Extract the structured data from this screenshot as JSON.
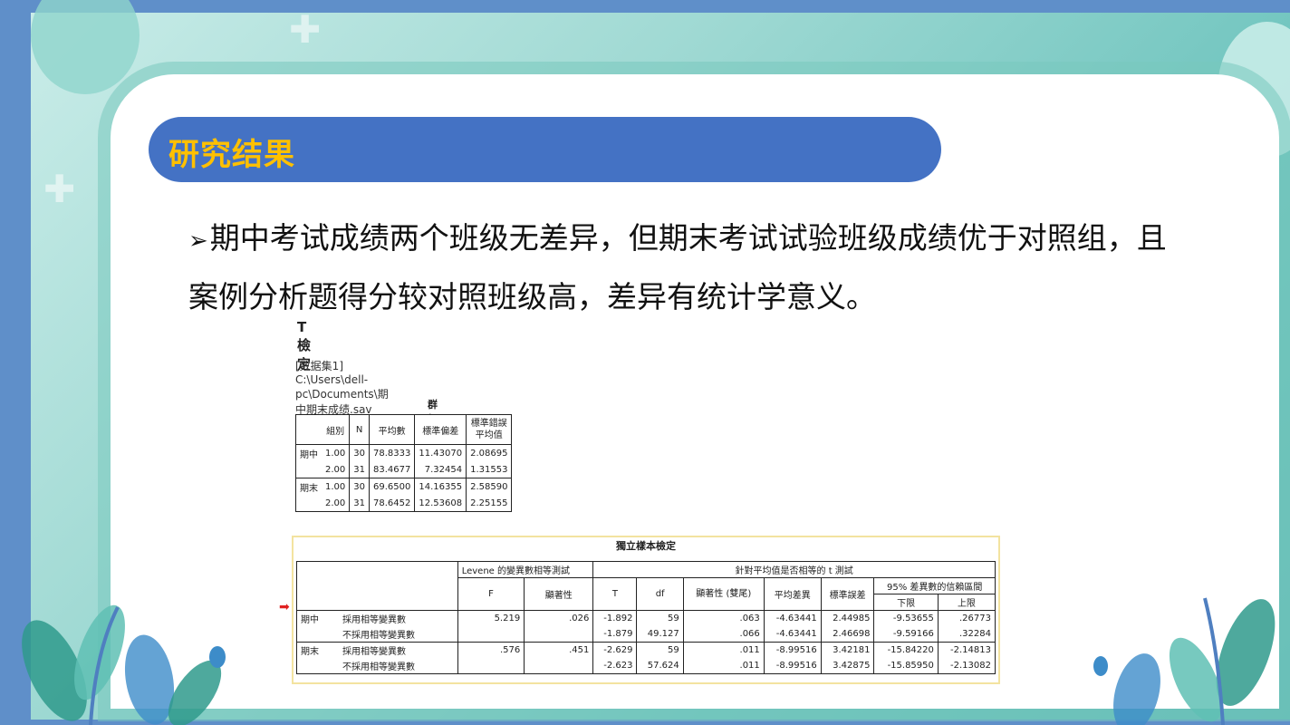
{
  "slide": {
    "title": "研究结果",
    "bullet": "➢",
    "line1": "期中考试成绩两个班级无差异，但期末考试试验班级成绩优于对照组，且",
    "line2": "案例分析题得分较对照班级高，差异有统计学意义。"
  },
  "spss": {
    "heading": "T 檢定",
    "dataset": "[数据集1] C:\\Users\\dell-pc\\Documents\\期中期末成绩.sav",
    "group_stats": {
      "caption": "群組統計資料",
      "headers": [
        "",
        "組別",
        "N",
        "平均數",
        "標準偏差",
        "標準錯誤平均值"
      ],
      "rows": [
        [
          "期中",
          "1.00",
          "30",
          "78.8333",
          "11.43070",
          "2.08695"
        ],
        [
          "",
          "2.00",
          "31",
          "83.4677",
          "7.32454",
          "1.31553"
        ],
        [
          "期末",
          "1.00",
          "30",
          "69.6500",
          "14.16355",
          "2.58590"
        ],
        [
          "",
          "2.00",
          "31",
          "78.6452",
          "12.53608",
          "2.25155"
        ]
      ]
    },
    "independent": {
      "caption": "獨立樣本檢定",
      "levene_header": "Levene 的變異數相等測試",
      "ttest_header": "針對平均值是否相等的 t 測試",
      "ci_header": "95% 差異數的信賴區間",
      "col_headers": [
        "F",
        "顯著性",
        "T",
        "df",
        "顯著性 (雙尾)",
        "平均差異",
        "標準誤差",
        "下限",
        "上限"
      ],
      "rows": [
        [
          "期中",
          "採用相等變異數",
          "5.219",
          ".026",
          "-1.892",
          "59",
          ".063",
          "-4.63441",
          "2.44985",
          "-9.53655",
          ".26773"
        ],
        [
          "",
          "不採用相等變異數",
          "",
          "",
          "-1.879",
          "49.127",
          ".066",
          "-4.63441",
          "2.46698",
          "-9.59166",
          ".32284"
        ],
        [
          "期末",
          "採用相等變異數",
          ".576",
          ".451",
          "-2.629",
          "59",
          ".011",
          "-8.99516",
          "3.42181",
          "-15.84220",
          "-2.14813"
        ],
        [
          "",
          "不採用相等變異數",
          "",
          "",
          "-2.623",
          "57.624",
          ".011",
          "-8.99516",
          "3.42875",
          "-15.85950",
          "-2.13082"
        ]
      ]
    }
  },
  "colors": {
    "title_bar": "#4472c4",
    "title_text": "#ffc000",
    "frame": "#6cc3bd"
  }
}
